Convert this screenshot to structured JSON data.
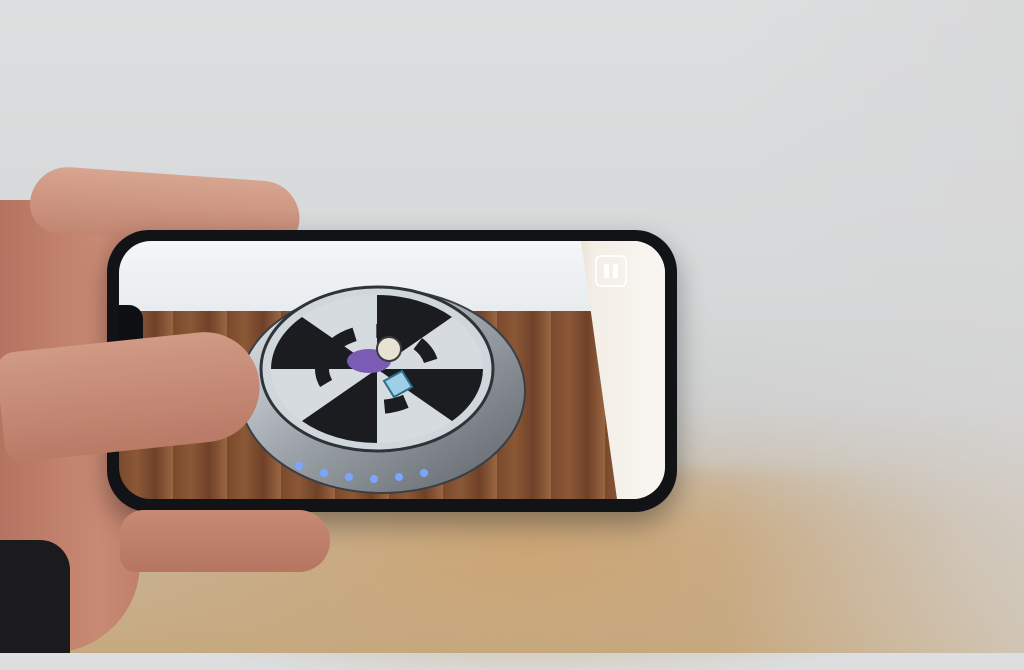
{
  "photo": {
    "description_visible_text": "",
    "pause_icon": "pause-icon"
  }
}
